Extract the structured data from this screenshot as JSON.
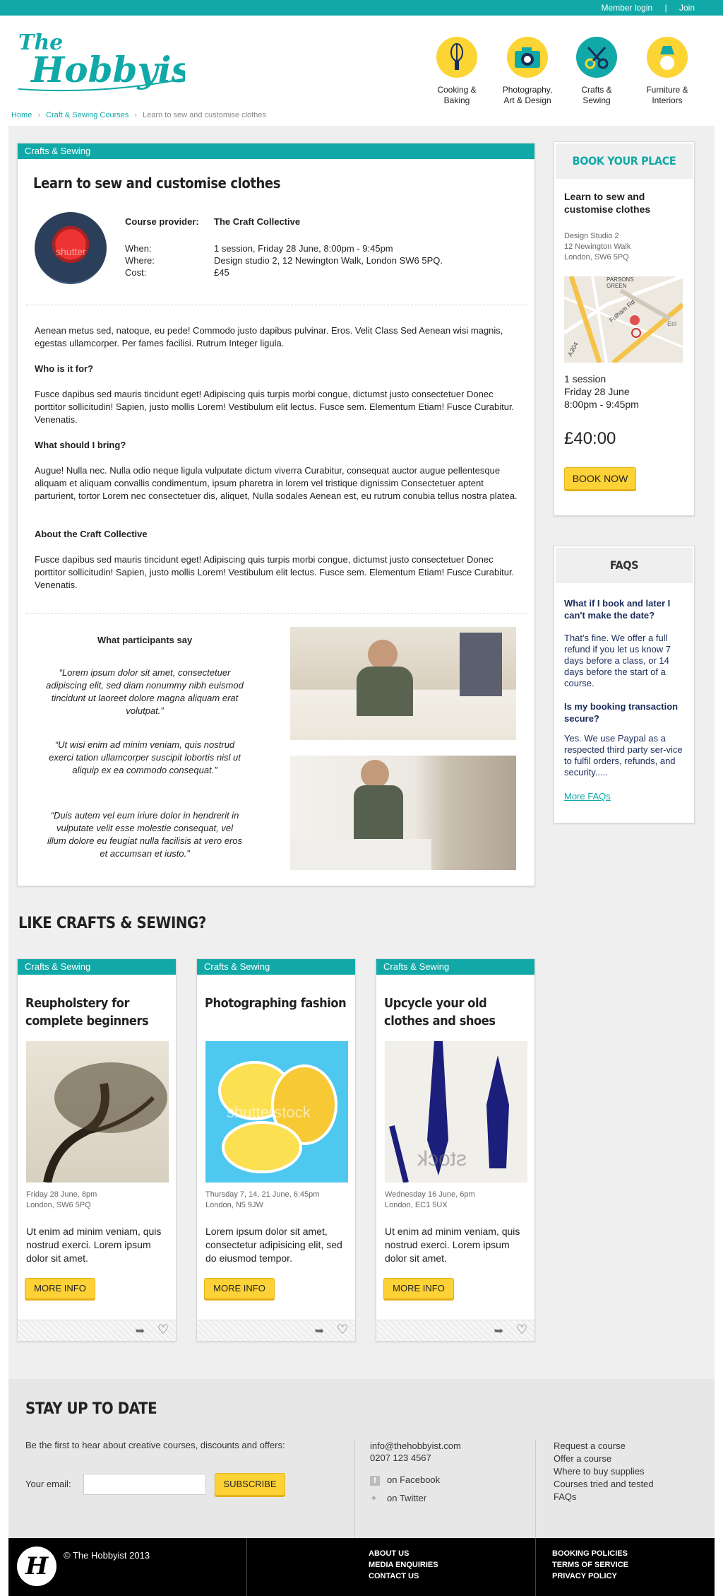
{
  "topbar": {
    "member_login": "Member login",
    "separator": "|",
    "join": "Join"
  },
  "logo": {
    "text": "The Hobbyist"
  },
  "nav": [
    {
      "label1": "Cooking &",
      "label2": "Baking",
      "icon": "whisk-icon",
      "color": "#fcd434"
    },
    {
      "label1": "Photography,",
      "label2": "Art & Design",
      "icon": "camera-icon",
      "color": "#fcd434"
    },
    {
      "label1": "Crafts &",
      "label2": "Sewing",
      "icon": "scissors-icon",
      "color": "#11a9a8"
    },
    {
      "label1": "Furniture &",
      "label2": "Interiors",
      "icon": "lamp-icon",
      "color": "#fcd434"
    }
  ],
  "breadcrumb": {
    "home": "Home",
    "section": "Craft & Sewing Courses",
    "current": "Learn to sew and customise clothes"
  },
  "course": {
    "category": "Crafts & Sewing",
    "title": "Learn to sew and customise clothes",
    "provider_label": "Course provider:",
    "provider": "The Craft Collective",
    "when_label": "When:",
    "when": "1 session, Friday 28 June, 8:00pm - 9:45pm",
    "where_label": "Where:",
    "where": "Design studio 2, 12 Newington Walk, London SW6 5PQ.",
    "cost_label": "Cost:",
    "cost": "£45",
    "avatar_watermark": "shutter",
    "intro": "Aenean metus sed, natoque, eu pede! Commodo justo dapibus pulvinar. Eros. Velit Class Sed Aenean wisi magnis, egestas ullamcorper. Per fames facilisi. Rutrum Integer ligula.",
    "h_who": "Who is it for?",
    "p_who": "Fusce dapibus sed mauris tincidunt eget! Adipiscing quis turpis morbi congue, dictumst justo consectetuer Donec porttitor sollicitudin! Sapien, justo mollis Lorem! Vestibulum elit lectus. Fusce sem. Elementum Etiam! Fusce Curabitur. Venenatis.",
    "h_bring": "What should I bring?",
    "p_bring": "Augue! Nulla nec. Nulla odio neque ligula vulputate dictum viverra Curabitur, consequat auctor augue pellentesque aliquam et aliquam convallis condimentum, ipsum pharetra in lorem vel tristique dignissim Consectetuer aptent parturient, tortor Lorem nec consectetuer dis, aliquet, Nulla sodales Aenean est, eu rutrum conubia tellus nostra platea.",
    "h_about": "About the Craft Collective",
    "p_about": "Fusce dapibus sed mauris tincidunt eget! Adipiscing quis turpis morbi congue, dictumst justo consectetuer Donec porttitor sollicitudin! Sapien, justo mollis Lorem! Vestibulum elit lectus. Fusce sem. Elementum Etiam! Fusce Curabitur. Venenatis.",
    "testimonials_title": "What participants say",
    "testimonials": [
      "“Lorem ipsum dolor sit amet, consectetuer adipiscing elit, sed diam nonummy nibh euismod tincidunt ut laoreet dolore magna aliquam erat volutpat.”",
      "“Ut wisi enim ad minim veniam, quis nostrud exerci tation ullamcorper suscipit lobortis nisl ut aliquip ex ea commodo consequat.”",
      "“Duis autem vel eum iriure dolor in hendrerit in vulputate velit esse molestie consequat, vel illum dolore eu feugiat nulla facilisis at vero eros et accumsan et iusto.”"
    ]
  },
  "booking": {
    "heading": "BOOK YOUR PLACE",
    "title": "Learn to sew and customise clothes",
    "address1": "Design Studio 2",
    "address2": "12 Newington Walk",
    "address3": "London, SW6 5PQ",
    "map_label1": "PARSONS",
    "map_label2": "GREEN",
    "map_label3": "Fulham Rd",
    "map_label4": "A304",
    "map_label5": "Eel",
    "session1": "1 session",
    "session2": "Friday 28 June",
    "session3": "8:00pm - 9:45pm",
    "price": "£40:00",
    "button": "BOOK NOW"
  },
  "faqs": {
    "heading": "FAQS",
    "q1": "What if I book and later I can't make the date?",
    "a1": "That's fine. We offer a full refund if you let us know 7 days before a class, or 14 days before the start of a course.",
    "q2": "Is my booking transaction secure?",
    "a2": "Yes. We use Paypal as a respected third party ser-vice to fulfil orders, refunds, and security.....",
    "more": "More FAQs"
  },
  "related": {
    "heading": "LIKE CRAFTS & SEWING?",
    "cards": [
      {
        "category": "Crafts & Sewing",
        "title": "Reupholstery for complete beginners",
        "date": "Friday 28 June, 8pm",
        "place": "London, SW6 5PQ",
        "desc": "Ut enim ad minim veniam, quis nostrud exerci. Lorem ipsum dolor sit amet.",
        "button": "MORE INFO"
      },
      {
        "category": "Crafts & Sewing",
        "title": "Photographing fashion",
        "date": "Thursday 7, 14, 21 June, 6:45pm",
        "place": "London, N5 9JW",
        "desc": "Lorem ipsum dolor sit amet, consectetur adipisicing elit, sed do eiusmod tempor.",
        "button": "MORE INFO",
        "watermark": "shutterstock"
      },
      {
        "category": "Crafts & Sewing",
        "title": "Upcycle your old clothes and shoes",
        "date": "Wednesday 16 June, 6pm",
        "place": "London, EC1 5UX",
        "desc": "Ut enim ad minim veniam, quis nostrud exerci. Lorem ipsum dolor sit amet.",
        "button": "MORE INFO",
        "watermark": "stock"
      }
    ]
  },
  "newsletter": {
    "heading": "STAY UP TO DATE",
    "text": "Be the first to hear about creative courses, discounts and offers:",
    "email_label": "Your email:",
    "email_value": "",
    "button": "SUBSCRIBE"
  },
  "contact": {
    "email": "info@thehobbyist.com",
    "phone": "0207 123 4567",
    "facebook": "on Facebook",
    "twitter": "on Twitter"
  },
  "links": [
    "Request a course",
    "Offer a course",
    "Where to buy supplies",
    "Courses tried and tested",
    "FAQs"
  ],
  "footer": {
    "copyright": "©  The Hobbyist 2013",
    "logo_letter": "H",
    "col1": [
      "ABOUT US",
      "MEDIA ENQUIRIES",
      "CONTACT US"
    ],
    "col2": [
      "BOOKING POLICIES",
      "TERMS OF SERVICE",
      "PRIVACY POLICY"
    ]
  },
  "colors": {
    "teal": "#11a9a8",
    "yellow": "#fcd434",
    "navy": "#1a2c5a"
  }
}
